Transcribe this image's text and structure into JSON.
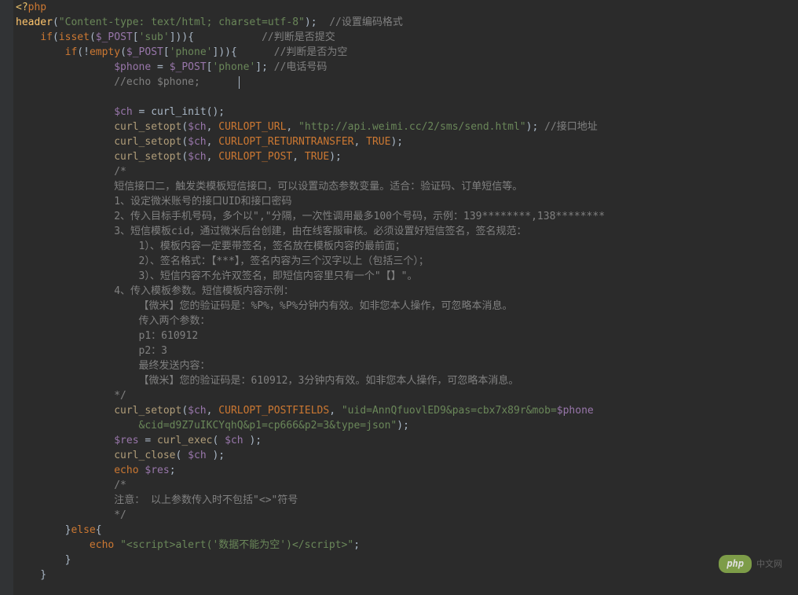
{
  "lines": [
    [
      {
        "t": "<?",
        "cls": "tag-open"
      },
      {
        "t": "php",
        "cls": "keyword"
      }
    ],
    [
      {
        "t": "header",
        "cls": "header-func"
      },
      {
        "t": "(",
        "cls": "paren"
      },
      {
        "t": "\"Content-type: text/html; charset=utf-8\"",
        "cls": "string"
      },
      {
        "t": ")",
        "cls": "paren"
      },
      {
        "t": ";  ",
        "cls": "op"
      },
      {
        "t": "//设置编码格式",
        "cls": "comment"
      }
    ],
    [
      {
        "t": "    ",
        "cls": ""
      },
      {
        "t": "if",
        "cls": "keyword"
      },
      {
        "t": "(",
        "cls": "paren"
      },
      {
        "t": "isset",
        "cls": "keyword"
      },
      {
        "t": "(",
        "cls": "paren"
      },
      {
        "t": "$_POST",
        "cls": "var"
      },
      {
        "t": "[",
        "cls": "paren"
      },
      {
        "t": "'sub'",
        "cls": "string"
      },
      {
        "t": "]",
        "cls": "paren"
      },
      {
        "t": ")){           ",
        "cls": "paren"
      },
      {
        "t": "//判断是否提交",
        "cls": "comment"
      }
    ],
    [
      {
        "t": "        ",
        "cls": ""
      },
      {
        "t": "if",
        "cls": "keyword"
      },
      {
        "t": "(!",
        "cls": "op"
      },
      {
        "t": "empty",
        "cls": "keyword"
      },
      {
        "t": "(",
        "cls": "paren"
      },
      {
        "t": "$_POST",
        "cls": "var"
      },
      {
        "t": "[",
        "cls": "paren"
      },
      {
        "t": "'phone'",
        "cls": "string"
      },
      {
        "t": "]",
        "cls": "paren"
      },
      {
        "t": ")){      ",
        "cls": "paren"
      },
      {
        "t": "//判断是否为空",
        "cls": "comment"
      }
    ],
    [
      {
        "t": "                ",
        "cls": ""
      },
      {
        "t": "$phone",
        "cls": "var"
      },
      {
        "t": " = ",
        "cls": "op"
      },
      {
        "t": "$_POST",
        "cls": "var"
      },
      {
        "t": "[",
        "cls": "paren"
      },
      {
        "t": "'phone'",
        "cls": "string"
      },
      {
        "t": "]",
        "cls": "paren"
      },
      {
        "t": "; ",
        "cls": "op"
      },
      {
        "t": "//电话号码",
        "cls": "comment"
      }
    ],
    [
      {
        "t": "                ",
        "cls": ""
      },
      {
        "t": "//echo $phone;",
        "cls": "comment"
      },
      {
        "t": "      ",
        "cls": ""
      },
      {
        "t": "",
        "cls": "cursor-marker"
      }
    ],
    [
      {
        "t": " ",
        "cls": ""
      }
    ],
    [
      {
        "t": "                ",
        "cls": ""
      },
      {
        "t": "$ch",
        "cls": "var"
      },
      {
        "t": " = ",
        "cls": "op"
      },
      {
        "t": "curl_init",
        "cls": "call"
      },
      {
        "t": "();",
        "cls": "paren"
      }
    ],
    [
      {
        "t": "                ",
        "cls": ""
      },
      {
        "t": "curl_setopt",
        "cls": "fname"
      },
      {
        "t": "(",
        "cls": "paren"
      },
      {
        "t": "$ch",
        "cls": "var"
      },
      {
        "t": ", ",
        "cls": "op"
      },
      {
        "t": "CURLOPT_URL",
        "cls": "const"
      },
      {
        "t": ", ",
        "cls": "op"
      },
      {
        "t": "\"http://api.weimi.cc/2/sms/send.html\"",
        "cls": "string"
      },
      {
        "t": "); ",
        "cls": "paren"
      },
      {
        "t": "//接口地址",
        "cls": "comment"
      }
    ],
    [
      {
        "t": "                ",
        "cls": ""
      },
      {
        "t": "curl_setopt",
        "cls": "fname"
      },
      {
        "t": "(",
        "cls": "paren"
      },
      {
        "t": "$ch",
        "cls": "var"
      },
      {
        "t": ", ",
        "cls": "op"
      },
      {
        "t": "CURLOPT_RETURNTRANSFER",
        "cls": "const"
      },
      {
        "t": ", ",
        "cls": "op"
      },
      {
        "t": "TRUE",
        "cls": "val-true"
      },
      {
        "t": ");",
        "cls": "paren"
      }
    ],
    [
      {
        "t": "                ",
        "cls": ""
      },
      {
        "t": "curl_setopt",
        "cls": "fname"
      },
      {
        "t": "(",
        "cls": "paren"
      },
      {
        "t": "$ch",
        "cls": "var"
      },
      {
        "t": ", ",
        "cls": "op"
      },
      {
        "t": "CURLOPT_POST",
        "cls": "const"
      },
      {
        "t": ", ",
        "cls": "op"
      },
      {
        "t": "TRUE",
        "cls": "val-true"
      },
      {
        "t": ");",
        "cls": "paren"
      }
    ],
    [
      {
        "t": "                ",
        "cls": ""
      },
      {
        "t": "/*",
        "cls": "comment"
      }
    ],
    [
      {
        "t": "                短信接口二，触发类模板短信接口，可以设置动态参数变量。适合：验证码、订单短信等。",
        "cls": "comment"
      }
    ],
    [
      {
        "t": "                1、设定微米账号的接口UID和接口密码",
        "cls": "comment"
      }
    ],
    [
      {
        "t": "                2、传入目标手机号码，多个以\",\"分隔，一次性调用最多100个号码，示例：139********,138********",
        "cls": "comment"
      }
    ],
    [
      {
        "t": "                3、短信模板cid，通过微米后台创建，由在线客服审核。必须设置好短信签名，签名规范：",
        "cls": "comment"
      }
    ],
    [
      {
        "t": "                    1）、模板内容一定要带签名，签名放在模板内容的最前面；",
        "cls": "comment"
      }
    ],
    [
      {
        "t": "                    2）、签名格式：【***】，签名内容为三个汉字以上（包括三个）；",
        "cls": "comment"
      }
    ],
    [
      {
        "t": "                    3）、短信内容不允许双签名，即短信内容里只有一个\"【】\"。",
        "cls": "comment"
      }
    ],
    [
      {
        "t": "                4、传入模板参数。短信模板内容示例：",
        "cls": "comment"
      }
    ],
    [
      {
        "t": "                    【微米】您的验证码是：%P%，%P%分钟内有效。如非您本人操作，可忽略本消息。",
        "cls": "comment"
      }
    ],
    [
      {
        "t": "                    传入两个参数：",
        "cls": "comment"
      }
    ],
    [
      {
        "t": "                    p1：610912",
        "cls": "comment"
      }
    ],
    [
      {
        "t": "                    p2：3",
        "cls": "comment"
      }
    ],
    [
      {
        "t": "                    最终发送内容：",
        "cls": "comment"
      }
    ],
    [
      {
        "t": "                    【微米】您的验证码是：610912，3分钟内有效。如非您本人操作，可忽略本消息。",
        "cls": "comment"
      }
    ],
    [
      {
        "t": "                */",
        "cls": "comment"
      }
    ],
    [
      {
        "t": "                ",
        "cls": ""
      },
      {
        "t": "curl_setopt",
        "cls": "fname"
      },
      {
        "t": "(",
        "cls": "paren"
      },
      {
        "t": "$ch",
        "cls": "var"
      },
      {
        "t": ", ",
        "cls": "op"
      },
      {
        "t": "CURLOPT_POSTFIELDS",
        "cls": "const"
      },
      {
        "t": ", ",
        "cls": "op"
      },
      {
        "t": "\"uid=AnnQfuovlED9&pas=cbx7x89r&mob=",
        "cls": "string"
      },
      {
        "t": "$phone",
        "cls": "var"
      }
    ],
    [
      {
        "t": "                    &cid=d9Z7uIKCYqhQ&p1=cp666&p2=3&type=json\"",
        "cls": "string"
      },
      {
        "t": ");",
        "cls": "paren"
      }
    ],
    [
      {
        "t": "                ",
        "cls": ""
      },
      {
        "t": "$res",
        "cls": "var"
      },
      {
        "t": " = ",
        "cls": "op"
      },
      {
        "t": "curl_exec",
        "cls": "fname"
      },
      {
        "t": "( ",
        "cls": "paren"
      },
      {
        "t": "$ch",
        "cls": "var"
      },
      {
        "t": " );",
        "cls": "paren"
      }
    ],
    [
      {
        "t": "                ",
        "cls": ""
      },
      {
        "t": "curl_close",
        "cls": "fname"
      },
      {
        "t": "( ",
        "cls": "paren"
      },
      {
        "t": "$ch",
        "cls": "var"
      },
      {
        "t": " );",
        "cls": "paren"
      }
    ],
    [
      {
        "t": "                ",
        "cls": ""
      },
      {
        "t": "echo",
        "cls": "keyword"
      },
      {
        "t": " ",
        "cls": ""
      },
      {
        "t": "$res",
        "cls": "var"
      },
      {
        "t": ";",
        "cls": "op"
      }
    ],
    [
      {
        "t": "                ",
        "cls": ""
      },
      {
        "t": "/*",
        "cls": "comment"
      }
    ],
    [
      {
        "t": "                注意： 以上参数传入时不包括\"<>\"符号",
        "cls": "comment"
      }
    ],
    [
      {
        "t": "                */",
        "cls": "comment"
      }
    ],
    [
      {
        "t": "        }",
        "cls": "paren"
      },
      {
        "t": "else",
        "cls": "keyword"
      },
      {
        "t": "{",
        "cls": "paren"
      }
    ],
    [
      {
        "t": "            ",
        "cls": ""
      },
      {
        "t": "echo",
        "cls": "keyword"
      },
      {
        "t": " ",
        "cls": ""
      },
      {
        "t": "\"<script>alert('数据不能为空')</script>\"",
        "cls": "string"
      },
      {
        "t": ";",
        "cls": "op"
      }
    ],
    [
      {
        "t": "        }",
        "cls": "paren"
      }
    ],
    [
      {
        "t": "    }",
        "cls": "paren"
      }
    ]
  ],
  "watermark": {
    "logo": "php",
    "text": "中文网"
  }
}
